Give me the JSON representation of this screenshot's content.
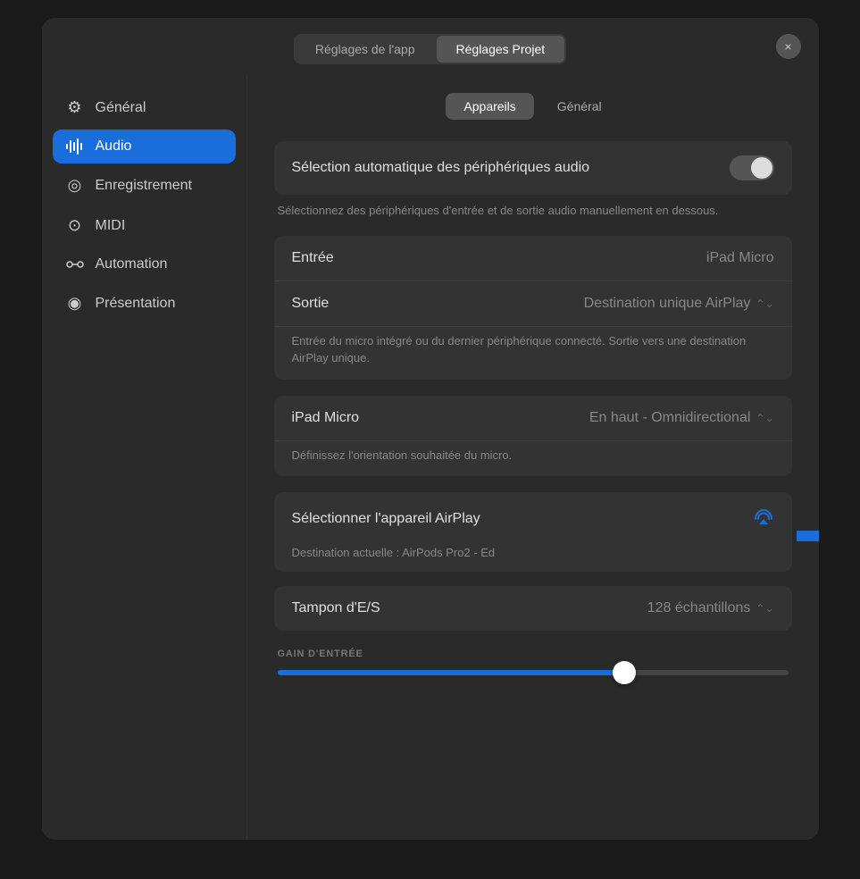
{
  "header": {
    "tab1_label": "Réglages de l'app",
    "tab2_label": "Réglages Projet",
    "close_icon": "×"
  },
  "sidebar": {
    "items": [
      {
        "id": "general",
        "label": "Général",
        "icon": "⚙"
      },
      {
        "id": "audio",
        "label": "Audio",
        "icon": "≋",
        "active": true
      },
      {
        "id": "enregistrement",
        "label": "Enregistrement",
        "icon": "◎"
      },
      {
        "id": "midi",
        "label": "MIDI",
        "icon": "⊙"
      },
      {
        "id": "automation",
        "label": "Automation",
        "icon": "⌗"
      },
      {
        "id": "presentation",
        "label": "Présentation",
        "icon": "◉"
      }
    ]
  },
  "subtabs": {
    "tab1": "Appareils",
    "tab2": "Général"
  },
  "auto_select": {
    "label": "Sélection automatique des périphériques audio",
    "description": "Sélectionnez des périphériques d'entrée et de sortie audio manuellement en dessous."
  },
  "io_card": {
    "entree_label": "Entrée",
    "entree_value": "iPad Micro",
    "sortie_label": "Sortie",
    "sortie_value": "Destination unique AirPlay",
    "description": "Entrée du micro intégré ou du dernier périphérique connecté. Sortie vers une destination AirPlay unique."
  },
  "ipad_micro": {
    "label": "iPad Micro",
    "value": "En haut - Omnidirectional",
    "description": "Définissez l'orientation souhaitée du micro."
  },
  "airplay": {
    "label": "Sélectionner l'appareil AirPlay",
    "destination": "Destination actuelle : AirPods Pro2 - Ed"
  },
  "buffer": {
    "label": "Tampon d'E/S",
    "value": "128 échantillons"
  },
  "gain": {
    "section_label": "GAIN D'ENTRÉE",
    "fill_percent": 68
  }
}
